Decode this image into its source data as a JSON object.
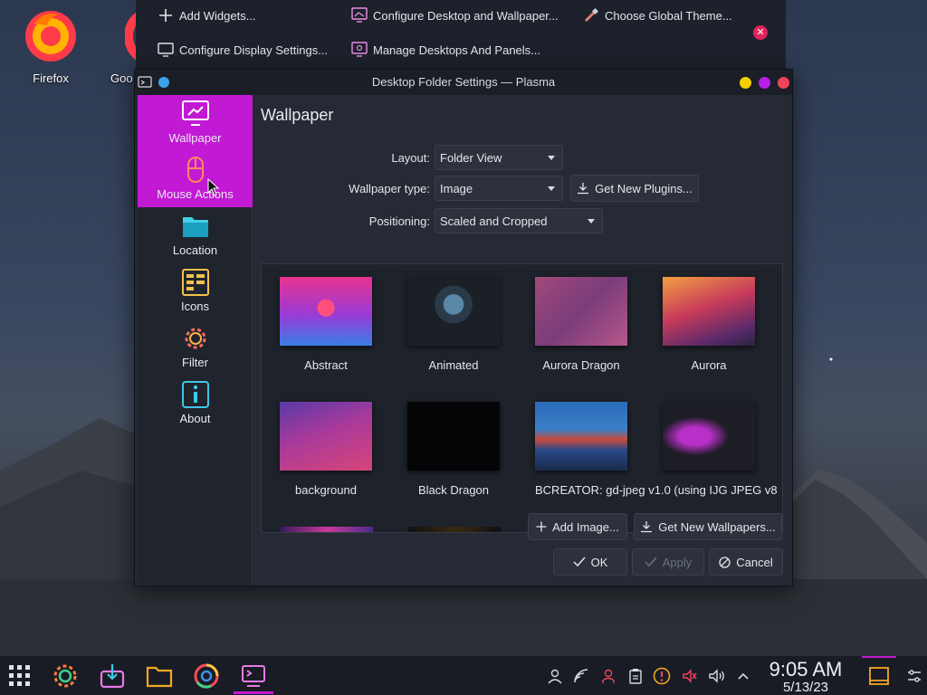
{
  "desktop": {
    "icons": [
      {
        "label": "Firefox",
        "icon": "firefox-icon"
      },
      {
        "label": "Goo",
        "icon": "chrome-icon"
      }
    ]
  },
  "toolbar": {
    "add_widgets": "Add Widgets...",
    "configure_display": "Configure Display Settings...",
    "configure_desktop": "Configure Desktop and Wallpaper...",
    "manage_desktops": "Manage Desktops And Panels...",
    "choose_theme": "Choose Global Theme..."
  },
  "window": {
    "title": "Desktop Folder Settings — Plasma",
    "sidebar": [
      {
        "label": "Wallpaper",
        "icon": "wallpaper-icon"
      },
      {
        "label": "Mouse Actions",
        "icon": "mouse-icon"
      },
      {
        "label": "Location",
        "icon": "folder-icon"
      },
      {
        "label": "Icons",
        "icon": "icons-grid-icon"
      },
      {
        "label": "Filter",
        "icon": "gear-icon"
      },
      {
        "label": "About",
        "icon": "info-icon"
      }
    ],
    "heading": "Wallpaper",
    "layout_label": "Layout:",
    "layout_value": "Folder View",
    "wallpaper_type_label": "Wallpaper type:",
    "wallpaper_type_value": "Image",
    "get_new_plugins": "Get New Plugins...",
    "positioning_label": "Positioning:",
    "positioning_value": "Scaled and Cropped",
    "wallpapers": [
      {
        "label": "Abstract"
      },
      {
        "label": "Animated"
      },
      {
        "label": "Aurora Dragon"
      },
      {
        "label": "Aurora"
      },
      {
        "label": "background"
      },
      {
        "label": "Black Dragon"
      },
      {
        "label": "BCREATOR: gd-jpeg v1.0 (using IJG JPEG v8"
      },
      {
        "label": ""
      }
    ],
    "add_image": "Add Image...",
    "get_new_wallpapers": "Get New Wallpapers...",
    "ok": "OK",
    "apply": "Apply",
    "cancel": "Cancel"
  },
  "taskbar": {
    "time": "9:05 AM",
    "date": "5/13/23"
  },
  "colors": {
    "accent": "#c219d4",
    "minimize": "#f5d000",
    "maximize": "#b81ee8",
    "close": "#f0445b"
  }
}
